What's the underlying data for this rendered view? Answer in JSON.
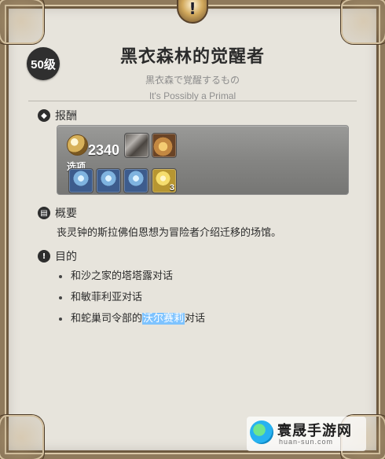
{
  "header": {
    "level_badge": "50级",
    "title": "黑衣森林的觉醒者",
    "subtitle_jp": "黒衣森で覚醒するもの",
    "subtitle_en": "It's Possibly a Primal"
  },
  "rewards": {
    "section_label": "报酬",
    "gil_icon": "gil-coin-icon",
    "gil_amount": "2340",
    "options_label": "选项",
    "reward_items": [
      {
        "icon": "armor-chest-icon"
      },
      {
        "icon": "leather-pouch-icon"
      }
    ],
    "option_items": [
      {
        "icon": "blue-crystal-icon"
      },
      {
        "icon": "blue-crystal-icon"
      },
      {
        "icon": "blue-crystal-icon"
      },
      {
        "icon": "gold-potion-icon",
        "count": "3"
      }
    ]
  },
  "summary": {
    "section_label": "概要",
    "text": "丧灵钟的斯拉佛伯恩想为冒险者介绍迁移的场馆。"
  },
  "objective": {
    "section_label": "目的",
    "items": [
      {
        "text": "和沙之家的塔塔露对话"
      },
      {
        "text": "和敏菲利亚对话"
      },
      {
        "prefix": "和蛇巢司令部的",
        "highlight": "沃尔赛莉",
        "suffix": "对话"
      }
    ]
  },
  "watermark": {
    "title": "寰晟手游网",
    "url": "huan-sun.com"
  },
  "colors": {
    "background": "#e7e4dc",
    "frame": "#8f7a5c",
    "reward_box": "#858583",
    "highlight": "#7ec3ff",
    "text": "#2b2b2b"
  }
}
